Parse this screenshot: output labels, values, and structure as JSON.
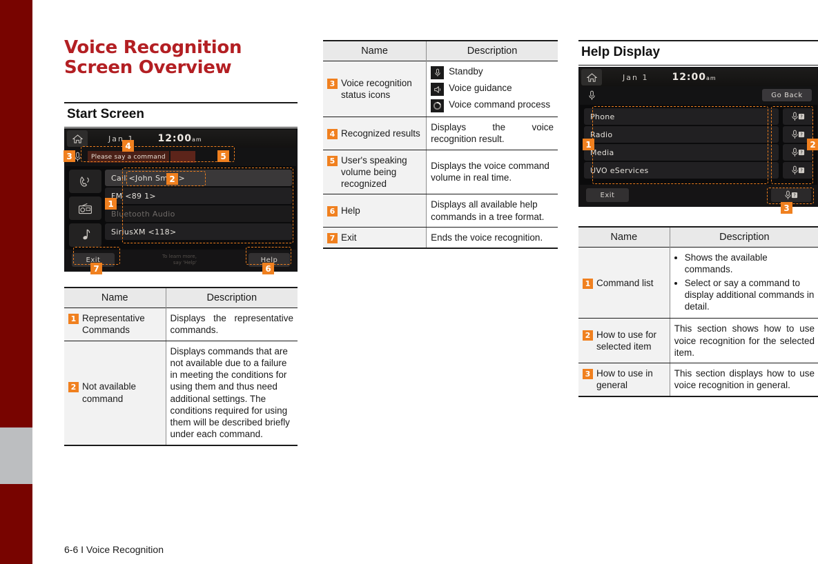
{
  "page": {
    "chapter_title_line1": "Voice Recognition",
    "chapter_title_line2": "Screen Overview",
    "footer": "6-6 I Voice Recognition",
    "accent_orange": "#F0801F",
    "title_red": "#B31F23",
    "edge_red": "#780400",
    "edge_gray": "#BCBEC0"
  },
  "start_screen": {
    "heading": "Start Screen",
    "head_unit": {
      "home_icon": "home-icon",
      "date": "Jan  1",
      "time": "12:00",
      "meridiem": "am",
      "status_icon": "microphone-icon",
      "recognized_text": "Please say a command",
      "side_icons": [
        "phone-icon",
        "radio-icon",
        "music-note-icon"
      ],
      "commands": [
        {
          "label": "Call <John Smith>",
          "state": "selected"
        },
        {
          "label": "FM <89 1>",
          "state": "normal"
        },
        {
          "label": "Bluetooth Audio",
          "state": "unavailable"
        },
        {
          "label": "SiriusXM <118>",
          "state": "normal"
        }
      ],
      "exit_label": "Exit",
      "help_label": "Help",
      "hint_line1": "To learn more,",
      "hint_line2": "say 'Help'"
    },
    "callouts": [
      "1",
      "2",
      "3",
      "4",
      "5",
      "6",
      "7"
    ]
  },
  "start_table": {
    "headers": [
      "Name",
      "Description"
    ],
    "rows": [
      {
        "num": "1",
        "name": "Representative Commands",
        "desc": "Displays the representative commands."
      },
      {
        "num": "2",
        "name": "Not available command",
        "desc": "Displays commands that are not available due to a failure in meeting the conditions for using them and thus need additional settings. The conditions required for using them will be described briefly under each command."
      }
    ]
  },
  "mid_table": {
    "headers": [
      "Name",
      "Description"
    ],
    "rows": [
      {
        "num": "3",
        "name": "Voice recognition status icons",
        "icon_items": [
          {
            "icon": "microphone-icon",
            "label": "Standby"
          },
          {
            "icon": "speaker-icon",
            "label": "Voice guidance"
          },
          {
            "icon": "processing-spinner-icon",
            "label": "Voice command process"
          }
        ]
      },
      {
        "num": "4",
        "name": "Recognized results",
        "desc": "Displays the voice recognition result."
      },
      {
        "num": "5",
        "name": "User's speaking volume being recognized",
        "desc": "Displays the voice command volume in real time."
      },
      {
        "num": "6",
        "name": "Help",
        "desc": "Displays all available help commands in a tree format."
      },
      {
        "num": "7",
        "name": "Exit",
        "desc": "Ends the voice recognition."
      }
    ]
  },
  "help_display": {
    "heading": "Help Display",
    "head_unit": {
      "home_icon": "home-icon",
      "date": "Jan  1",
      "time": "12:00",
      "meridiem": "am",
      "status_icon": "microphone-icon",
      "go_back_label": "Go Back",
      "commands": [
        "Phone",
        "Radio",
        "Media",
        "UVO eServices"
      ],
      "help_icon": "microphone-question-icon",
      "exit_label": "Exit"
    },
    "callouts": [
      "1",
      "2",
      "3"
    ]
  },
  "help_table": {
    "headers": [
      "Name",
      "Description"
    ],
    "rows": [
      {
        "num": "1",
        "name": "Command list",
        "bullets": [
          "Shows the available commands.",
          "Select or say a command to display additional commands in detail."
        ]
      },
      {
        "num": "2",
        "name": "How to use for selected item",
        "desc": "This section shows how to use voice recognition for the selected item."
      },
      {
        "num": "3",
        "name": "How to use in general",
        "desc": "This section displays how to use voice recognition in general."
      }
    ]
  }
}
